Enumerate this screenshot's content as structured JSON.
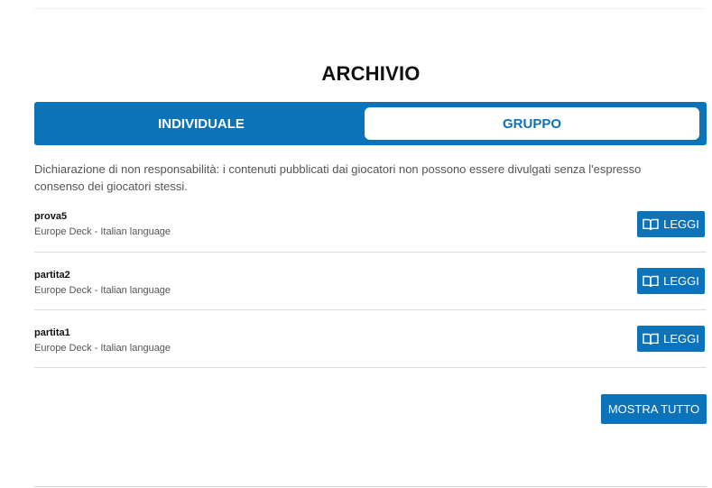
{
  "page": {
    "title": "ARCHIVIO"
  },
  "tabs": [
    {
      "label": "INDIVIDUALE",
      "active": true
    },
    {
      "label": "GRUPPO",
      "active": false
    }
  ],
  "disclaimer": "Dichiarazione di non responsabilità: i contenuti pubblicati dai giocatori non possono essere divulgati senza l'espresso consenso dei giocatori stessi.",
  "items": [
    {
      "title": "prova5",
      "subtitle": "Europe Deck - Italian language",
      "button_label": "LEGGI",
      "button_icon": "book-icon"
    },
    {
      "title": "partita2",
      "subtitle": "Europe Deck - Italian language",
      "button_label": "LEGGI",
      "button_icon": "book-icon"
    },
    {
      "title": "partita1",
      "subtitle": "Europe Deck - Italian language",
      "button_label": "LEGGI",
      "button_icon": "book-icon"
    }
  ],
  "show_all_label": "MOSTRA TUTTO",
  "colors": {
    "primary": "#0d73b8",
    "background": "#ffffff",
    "text": "#212529",
    "muted": "#555555"
  }
}
